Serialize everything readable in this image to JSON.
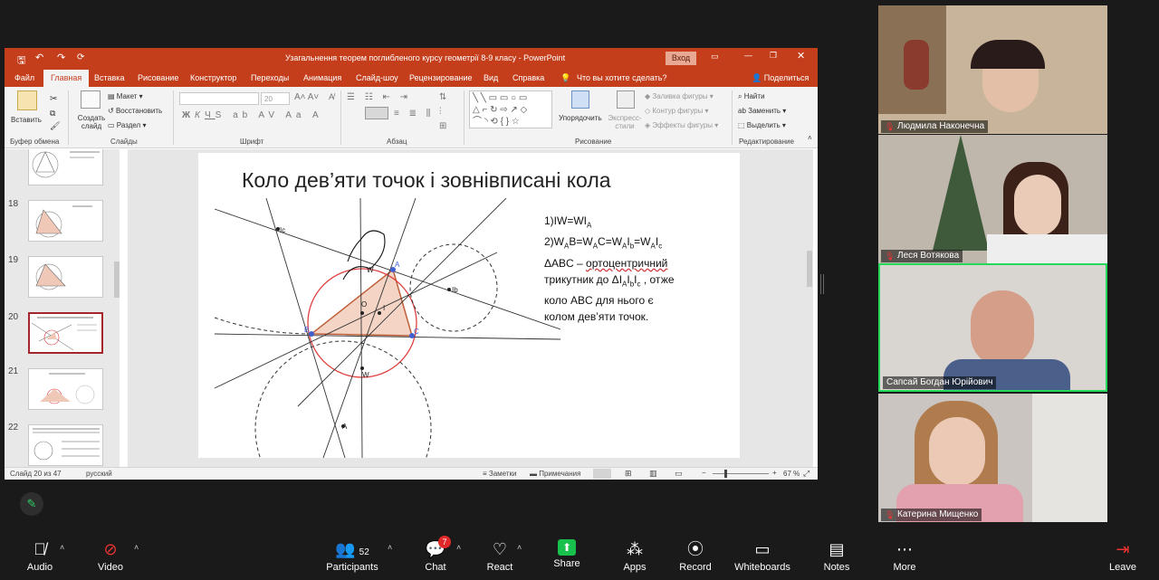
{
  "powerpoint": {
    "window_title": "Узагальнення теорем поглибленого курсу геометрії 8-9 класу - PowerPoint",
    "login_button": "Вход",
    "tabs": [
      "Файл",
      "Главная",
      "Вставка",
      "Рисование",
      "Конструктор",
      "Переходы",
      "Анимация",
      "Слайд-шоу",
      "Рецензирование",
      "Вид",
      "Справка"
    ],
    "tell_me": "Что вы хотите сделать?",
    "share": "Поделиться",
    "ribbon": {
      "paste": "Вставить",
      "clipboard": "Буфер обмена",
      "new_slide": "Создать слайд",
      "layout": "Макет",
      "reset": "Восстановить",
      "section": "Раздел",
      "slides": "Слайды",
      "font_size": "20",
      "font": "Шрифт",
      "paragraph": "Абзац",
      "arrange": "Упорядочить",
      "quick_styles": "Экспресс-стили",
      "shape_fill": "Заливка фигуры",
      "shape_outline": "Контур фигуры",
      "shape_effects": "Эффекты фигуры",
      "drawing": "Рисование",
      "find": "Найти",
      "replace": "Заменить",
      "select": "Выделить",
      "editing": "Редактирование"
    },
    "thumb_numbers": [
      "18",
      "19",
      "20",
      "21",
      "22"
    ],
    "slide": {
      "title": "Коло дев’яти точок і зовнівписані кола",
      "line1": "1)IW=WI",
      "line1_sub": "A",
      "line2": "2)W",
      "line2_rest": "ΔABC – ортоцентричний трикутник до ΔI",
      "line3": "коло ABC для нього є",
      "line4": "колом дев’яти точок."
    },
    "status": {
      "slide_of": "Слайд 20 из 47",
      "language": "русский",
      "notes": "Заметки",
      "comments": "Примечания",
      "zoom": "67 %"
    }
  },
  "participants_video": [
    {
      "name": "Людмила Наконечна",
      "bg": "#b9a48c"
    },
    {
      "name": "Леся Вотякова",
      "bg": "#b8b0a8"
    },
    {
      "name": "Сапсай Богдан Юрійович",
      "bg": "#d8d4d0"
    },
    {
      "name": "Катерина Мищенко",
      "bg": "#c9c4c0"
    }
  ],
  "toolbar": {
    "audio": "Audio",
    "video": "Video",
    "participants": "Participants",
    "participants_count": "52",
    "chat": "Chat",
    "chat_badge": "7",
    "react": "React",
    "share": "Share",
    "apps": "Apps",
    "record": "Record",
    "whiteboards": "Whiteboards",
    "notes": "Notes",
    "more": "More",
    "leave": "Leave"
  },
  "colors": {
    "ppt_accent": "#c43e1c",
    "active_speaker": "#23d959",
    "share_green": "#17c14b"
  }
}
